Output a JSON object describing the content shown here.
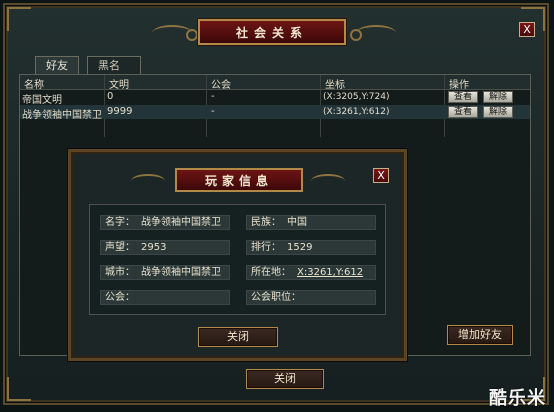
{
  "window": {
    "title": "社会关系",
    "close_label": "X"
  },
  "tabs": [
    {
      "label": "好友",
      "active": true
    },
    {
      "label": "黑名单",
      "active": false
    }
  ],
  "table": {
    "headers": [
      "名称",
      "文明",
      "公会",
      "坐标",
      "操作"
    ],
    "rows": [
      {
        "name": "帝国文明",
        "civ": "0",
        "guild": "-",
        "coord": "(X:3205,Y:724)",
        "view": "查看",
        "remove": "解除",
        "selected": false
      },
      {
        "name": "战争领袖中国禁卫",
        "civ": "9999",
        "guild": "-",
        "coord": "(X:3261,Y:612)",
        "view": "查看",
        "remove": "解除",
        "selected": true
      }
    ]
  },
  "add_friend_label": "增加好友",
  "close_label": "关闭",
  "popup": {
    "title": "玩家信息",
    "close_icon": "X",
    "fields": {
      "name_label": "名字：",
      "name_value": "战争领袖中国禁卫",
      "race_label": "民族：",
      "race_value": "中国",
      "fame_label": "声望：",
      "fame_value": "2953",
      "rank_label": "排行：",
      "rank_value": "1529",
      "city_label": "城市：",
      "city_value": "战争领袖中国禁卫",
      "loc_label": "所在地：",
      "loc_value": "X:3261,Y:612",
      "guild_label": "公会：",
      "guild_value": "",
      "guildpos_label": "公会职位：",
      "guildpos_value": ""
    },
    "close_label": "关闭"
  },
  "watermark": "酷乐米",
  "colors": {
    "title_red": "#6d1414",
    "gold_border": "#b18a48",
    "panel_bg": "#1c2626"
  }
}
